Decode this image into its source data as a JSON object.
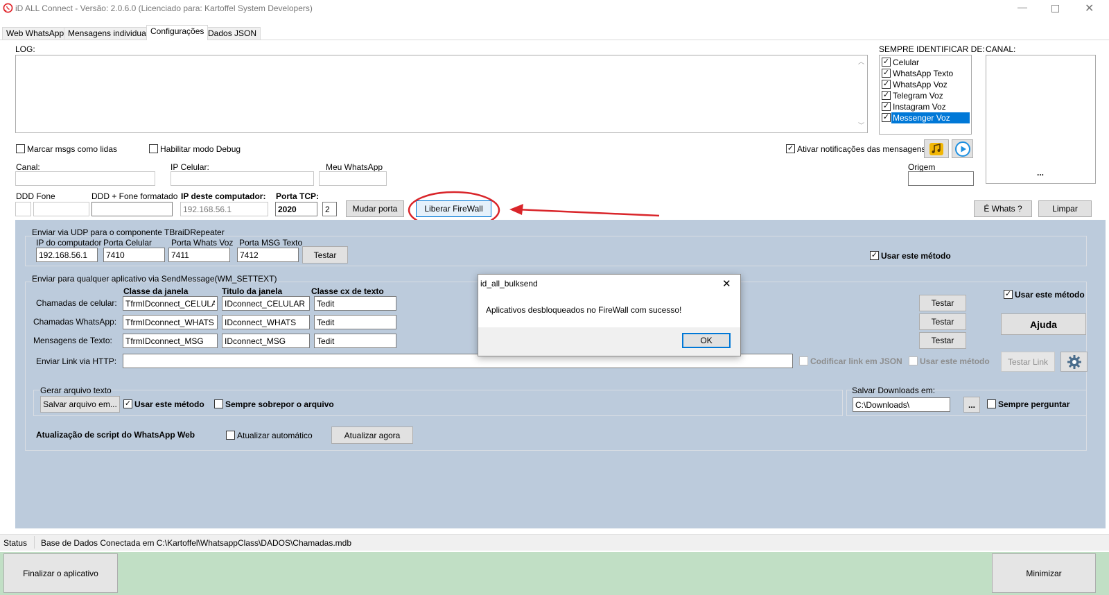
{
  "window": {
    "title": "iD ALL Connect - Versão: 2.0.6.0 (Licenciado para: Kartoffel System Developers)",
    "icon": "whatsapp-icon"
  },
  "tabs": [
    {
      "label": "Web WhatsApp"
    },
    {
      "label": "Mensagens individuais"
    },
    {
      "label": "Configurações",
      "active": true
    },
    {
      "label": "Dados JSON"
    }
  ],
  "log": {
    "label": "LOG:",
    "value": ""
  },
  "identify": {
    "label": "SEMPRE IDENTIFICAR DE:",
    "items": [
      {
        "label": "Celular",
        "checked": true
      },
      {
        "label": "WhatsApp Texto",
        "checked": true
      },
      {
        "label": "WhatsApp Voz",
        "checked": true
      },
      {
        "label": "Telegram Voz",
        "checked": true
      },
      {
        "label": "Instagram Voz",
        "checked": true
      },
      {
        "label": "Messenger Voz",
        "checked": true,
        "selected": true
      }
    ]
  },
  "canal_box": {
    "label": "CANAL:",
    "more": "..."
  },
  "options": {
    "mark_read": "Marcar msgs como lidas",
    "debug": "Habilitar modo Debug",
    "notifications": "Ativar notificações das mensagens"
  },
  "fields": {
    "canal": {
      "label": "Canal:",
      "value": ""
    },
    "ip_celular": {
      "label": "IP Celular:",
      "value": ""
    },
    "meu_whatsapp": {
      "label": "Meu WhatsApp",
      "value": ""
    },
    "origem": {
      "label": "Origem",
      "value": ""
    },
    "ddd_fone": {
      "label": "DDD Fone"
    },
    "ddd_fone_fmt": {
      "label": "DDD + Fone formatado",
      "value": ""
    },
    "ip_computador": {
      "label": "IP deste computador:",
      "value": "192.168.56.1"
    },
    "porta_tcp": {
      "label": "Porta TCP:",
      "value": "2020",
      "extra": "2"
    }
  },
  "buttons": {
    "mudar_porta": "Mudar porta",
    "liberar_firewall": "Liberar FireWall",
    "e_whats": "É Whats ?",
    "limpar": "Limpar",
    "testar": "Testar",
    "ajuda": "Ajuda",
    "testar_link": "Testar Link",
    "salvar_arquivo": "Salvar arquivo em...",
    "browse": "...",
    "atualizar_agora": "Atualizar agora",
    "finalizar": "Finalizar o aplicativo",
    "minimizar": "Minimizar"
  },
  "udp": {
    "title": "Enviar via UDP para o componente TBraiDRepeater",
    "ip_label": "IP do computador",
    "porta_celular_label": "Porta Celular",
    "porta_whats_voz_label": "Porta  Whats Voz",
    "porta_msg_texto_label": "Porta  MSG Texto",
    "ip_value": "192.168.56.1",
    "porta_celular": "7410",
    "porta_whats_voz": "7411",
    "porta_msg_texto": "7412",
    "use_method": "Usar este método"
  },
  "sendmsg": {
    "title": "Enviar para qualquer aplicativo via SendMessage(WM_SETTEXT)",
    "col_class": "Classe da janela",
    "col_title": "Titulo da janela",
    "col_textclass": "Classe cx de texto",
    "use_method": "Usar este método",
    "rows": [
      {
        "label": "Chamadas de celular:",
        "class": "TfrmIDconnect_CELULAR",
        "title": "IDconnect_CELULAR",
        "textclass": "Tedit"
      },
      {
        "label": "Chamadas WhatsApp:",
        "class": "TfrmIDconnect_WHATS",
        "title": "IDconnect_WHATS",
        "textclass": "Tedit"
      },
      {
        "label": "Mensagens de Texto:",
        "class": "TfrmIDconnect_MSG",
        "title": "IDconnect_MSG",
        "textclass": "Tedit"
      }
    ]
  },
  "http": {
    "label": "Enviar Link via HTTP:",
    "value": "",
    "json_label": "Codificar link em JSON",
    "use_method": "Usar este método"
  },
  "file": {
    "title": "Gerar arquivo texto",
    "use_method": "Usar este método",
    "overwrite": "Sempre sobrepor o arquivo",
    "downloads_label": "Salvar Downloads em:",
    "downloads_value": "C:\\Downloads\\",
    "ask": "Sempre perguntar"
  },
  "script_update": {
    "label": "Atualização de script do WhatsApp Web",
    "auto": "Atualizar automático"
  },
  "status": {
    "label": "Status",
    "text": "Base de Dados Conectada em C:\\Kartoffel\\WhatsappClass\\DADOS\\Chamadas.mdb"
  },
  "dialog": {
    "title": "id_all_bulksend",
    "message": "Aplicativos desbloqueados no FireWall com sucesso!",
    "ok": "OK"
  },
  "colors": {
    "panel": "#bccbdc",
    "footer": "#c1dfc5",
    "annotation": "#d9252a",
    "selection": "#0078d7"
  }
}
